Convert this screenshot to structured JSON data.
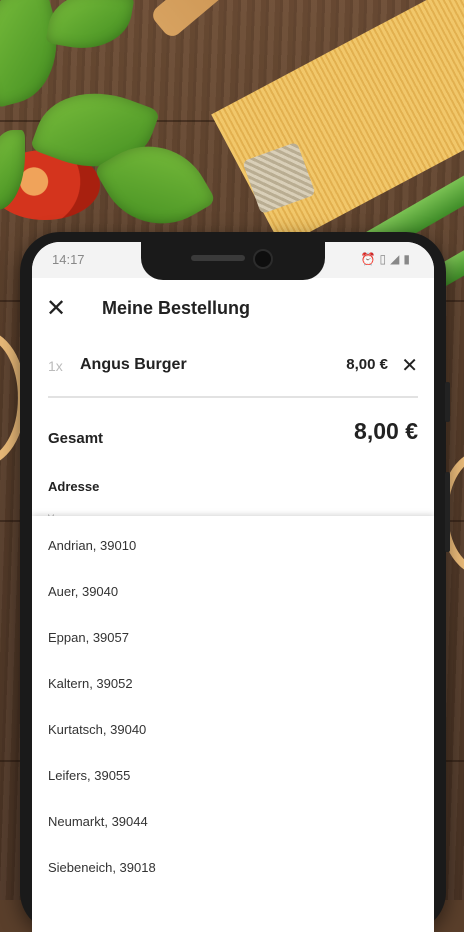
{
  "status_bar": {
    "time": "14:17",
    "icons": [
      "alarm-icon",
      "vibrate-icon",
      "signal-icon",
      "battery-icon"
    ]
  },
  "header": {
    "title": "Meine Bestellung",
    "close_icon": "close-icon"
  },
  "order": {
    "items": [
      {
        "qty": "1x",
        "name": "Angus Burger",
        "price": "8,00 €"
      }
    ],
    "total_label": "Gesamt",
    "total_value": "8,00 €"
  },
  "address": {
    "label": "Adresse",
    "first_name_label": "Vorname"
  },
  "dropdown": {
    "options": [
      "Andrian, 39010",
      "Auer, 39040",
      "Eppan, 39057",
      "Kaltern, 39052",
      "Kurtatsch, 39040",
      "Leifers, 39055",
      "Neumarkt, 39044",
      "Siebeneich, 39018"
    ]
  }
}
